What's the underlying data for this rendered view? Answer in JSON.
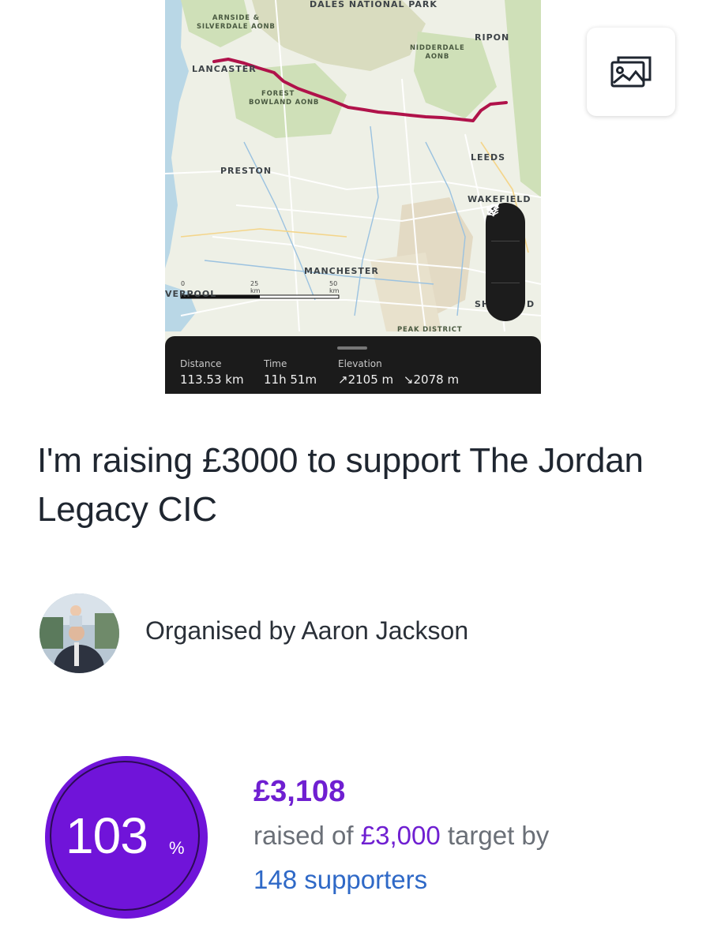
{
  "map": {
    "labels": {
      "dales": "DALES NATIONAL PARK",
      "arnside": "ARNSIDE &",
      "arnside2": "SILVERDALE AONB",
      "ripon": "RIPON",
      "nidderdale": "NIDDERDALE",
      "nidderdale2": "AONB",
      "lancaster": "LANCASTER",
      "forest": "FOREST",
      "bowland": "BOWLAND AONB",
      "leeds": "LEEDS",
      "wakefield": "WAKEFIELD",
      "preston": "PRESTON",
      "manchester": "MANCHESTER",
      "peak": "PEAK DISTRICT",
      "liverpool": "VERPOOL",
      "sheffield_a": "SH",
      "sheffield_b": "D"
    },
    "scale": {
      "zero": "0",
      "mid": "25 km",
      "end": "50 km"
    },
    "route_color": "#b0124a",
    "controls": [
      "expand-icon",
      "layers-icon",
      "locate-icon"
    ],
    "stats": {
      "distance_label": "Distance",
      "distance_value": "113.53 km",
      "time_label": "Time",
      "time_value": "11h 51m",
      "elevation_label": "Elevation",
      "elevation_up": "2105 m",
      "elevation_down": "2078 m"
    }
  },
  "gallery_button": {
    "icon": "gallery-icon"
  },
  "campaign": {
    "title": "I'm raising £3000 to support The Jordan Legacy CIC",
    "organiser": "Organised by Aaron Jackson",
    "percent": "103",
    "percent_sign": "%",
    "percent_value": 1.03,
    "raised": "£3,108",
    "raised_prefix": "raised of ",
    "target": "£3,000",
    "raised_suffix": " target by",
    "supporters": "148 supporters"
  },
  "colors": {
    "brand_purple": "#7014d9",
    "link_blue": "#2f69c7",
    "text_grey": "#6a6f77"
  }
}
